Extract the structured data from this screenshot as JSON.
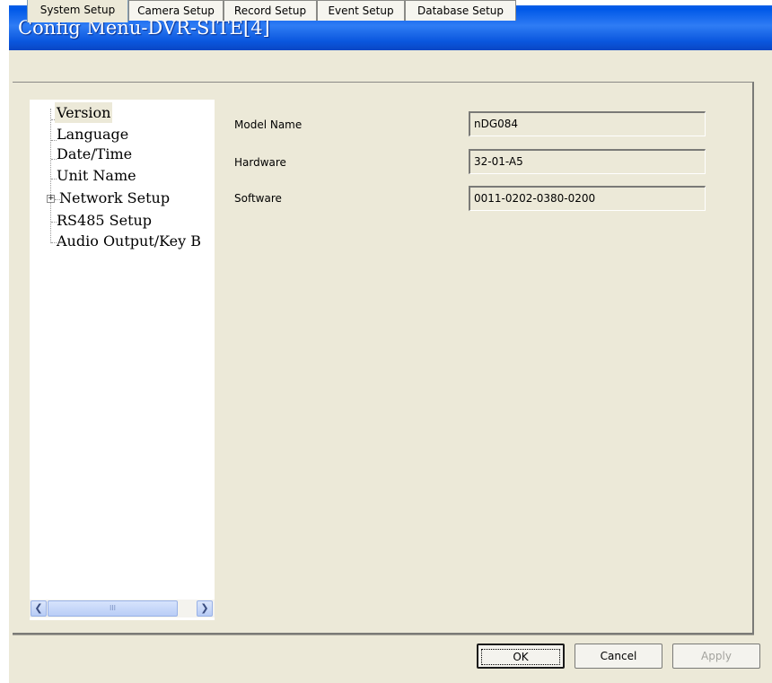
{
  "window": {
    "title": "Config Menu-DVR-SITE[4]"
  },
  "tabs": [
    {
      "label": "System Setup",
      "active": true
    },
    {
      "label": "Camera Setup",
      "active": false
    },
    {
      "label": "Record Setup",
      "active": false
    },
    {
      "label": "Event Setup",
      "active": false
    },
    {
      "label": "Database Setup",
      "active": false
    }
  ],
  "tree": {
    "items": [
      {
        "label": "Version",
        "selected": true
      },
      {
        "label": "Language"
      },
      {
        "label": "Date/Time"
      },
      {
        "label": "Unit Name"
      },
      {
        "label": "Network Setup",
        "expandable": true
      },
      {
        "label": "RS485 Setup"
      },
      {
        "label": "Audio Output/Key B"
      }
    ],
    "scroll_thumb_grip": "III"
  },
  "info": {
    "model_name_label": "Model Name",
    "model_name_value": "nDG084",
    "hardware_label": "Hardware",
    "hardware_value": "32-01-A5",
    "software_label": "Software",
    "software_value": "0011-0202-0380-0200"
  },
  "buttons": {
    "ok": "OK",
    "cancel": "Cancel",
    "apply": "Apply"
  }
}
